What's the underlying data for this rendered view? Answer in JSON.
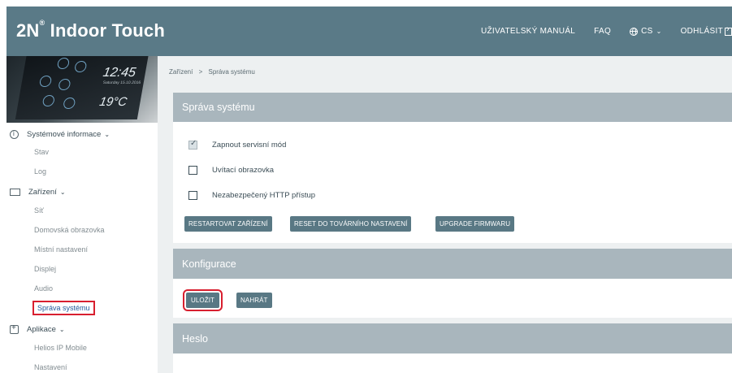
{
  "header": {
    "logo_text": "2N",
    "logo_reg": "®",
    "logo_rest": " Indoor Touch",
    "nav": {
      "manual": "UŽIVATELSKÝ MANUÁL",
      "faq": "FAQ",
      "lang": "CS",
      "logout": "ODHLÁSIT"
    }
  },
  "device_preview": {
    "time": "12:45",
    "date": "Saturday 15.10.2016",
    "temperature": "19°C"
  },
  "sidebar": {
    "groups": [
      {
        "label": "Systémové informace",
        "icon": "info-icon",
        "items": [
          "Stav",
          "Log"
        ]
      },
      {
        "label": "Zařízení",
        "icon": "device-icon",
        "items": [
          "Síť",
          "Domovská obrazovka",
          "Místní nastavení",
          "Displej",
          "Audio",
          "Správa systému"
        ]
      },
      {
        "label": "Aplikace",
        "icon": "app-icon",
        "items": [
          "Helios IP Mobile",
          "Nastavení"
        ]
      }
    ],
    "active_item": "Správa systému"
  },
  "breadcrumb": {
    "parent": "Zařízení",
    "separator": ">",
    "current": "Správa systému"
  },
  "system_card": {
    "title": "Správa systému",
    "checkboxes": [
      {
        "label": "Zapnout servisní mód",
        "checked": true
      },
      {
        "label": "Uvítací obrazovka",
        "checked": false
      },
      {
        "label": "Nezabezpečený HTTP přístup",
        "checked": false
      }
    ],
    "buttons": {
      "restart": "RESTARTOVAT ZAŘÍZENÍ",
      "reset": "RESET DO TOVÁRNÍHO NASTAVENÍ",
      "upgrade": "UPGRADE FIRMWARU"
    }
  },
  "config_card": {
    "title": "Konfigurace",
    "buttons": {
      "save": "ULOŽIT",
      "upload": "NAHRÁT"
    }
  },
  "password_card": {
    "title": "Heslo"
  },
  "colors": {
    "header": "#5a7a87",
    "card_header": "#a9b6bd",
    "button": "#597884",
    "highlight": "#d81f2f",
    "active_link": "#245a9c"
  }
}
